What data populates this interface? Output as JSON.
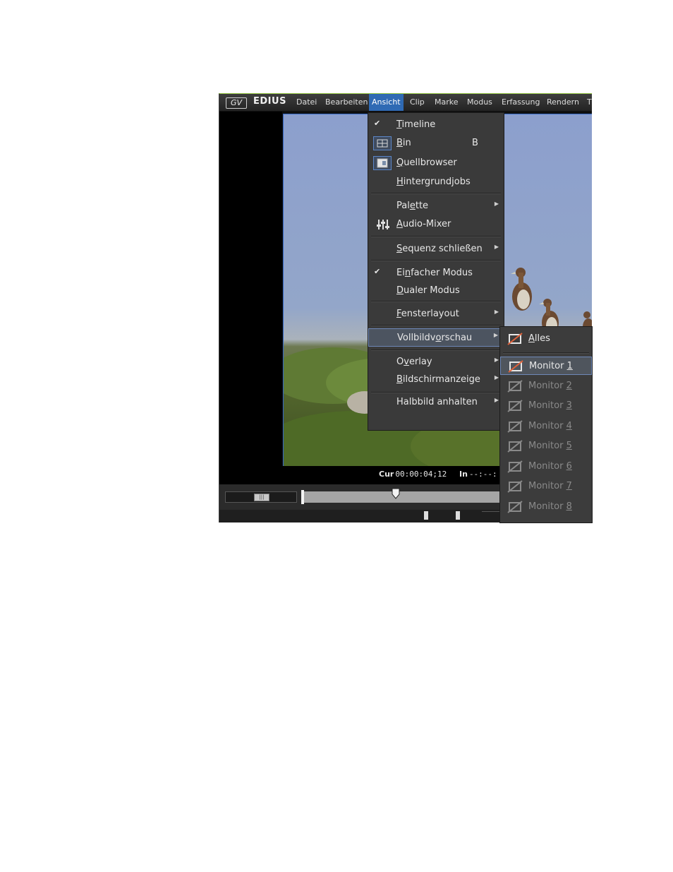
{
  "app": {
    "brand": "EDIUS",
    "logo": "GV",
    "menu": [
      "Datei",
      "Bearbeiten",
      "Ansicht",
      "Clip",
      "Marke",
      "Modus",
      "Erfassung",
      "Rendern",
      "T"
    ]
  },
  "ansicht_menu": {
    "timeline": {
      "pre": "",
      "u": "T",
      "post": "imeline"
    },
    "bin": {
      "pre": "",
      "u": "B",
      "post": "in",
      "accel": "B"
    },
    "quellbrowser": {
      "pre": "",
      "u": "Q",
      "post": "uellbrowser"
    },
    "hintergrundjobs": {
      "pre": "",
      "u": "H",
      "post": "intergrundjobs"
    },
    "palette": {
      "pre": "Pal",
      "u": "e",
      "post": "tte"
    },
    "audio_mixer": {
      "pre": "",
      "u": "A",
      "post": "udio-Mixer"
    },
    "sequenz": {
      "pre": "",
      "u": "S",
      "post": "equenz schließen"
    },
    "einfacher": {
      "pre": "Ei",
      "u": "n",
      "post": "facher Modus"
    },
    "dualer": {
      "pre": "",
      "u": "D",
      "post": "ualer Modus"
    },
    "fensterlayout": {
      "pre": "",
      "u": "F",
      "post": "ensterlayout"
    },
    "vollbild": {
      "pre": "Vollbildv",
      "u": "o",
      "post": "rschau"
    },
    "overlay": {
      "pre": "O",
      "u": "v",
      "post": "erlay"
    },
    "bildschirm": {
      "pre": "",
      "u": "B",
      "post": "ildschirmanzeige"
    },
    "halbbild": {
      "pre": "Halbbild anhalten",
      "u": "",
      "post": ""
    }
  },
  "submenu": {
    "alles": {
      "pre": "",
      "u": "A",
      "post": "lles"
    },
    "monitors": [
      {
        "pre": "Monitor ",
        "u": "1"
      },
      {
        "pre": "Monitor ",
        "u": "2"
      },
      {
        "pre": "Monitor ",
        "u": "3"
      },
      {
        "pre": "Monitor ",
        "u": "4"
      },
      {
        "pre": "Monitor ",
        "u": "5"
      },
      {
        "pre": "Monitor ",
        "u": "6"
      },
      {
        "pre": "Monitor ",
        "u": "7"
      },
      {
        "pre": "Monitor ",
        "u": "8"
      }
    ]
  },
  "timecode": {
    "cur_label": "Cur",
    "cur_value": "00:00:04;12",
    "in_label": "In",
    "in_value": "--:--:"
  },
  "colors": {
    "menubar_active": "#2f6ab4",
    "menu_bg": "#3a3a3a",
    "highlight_border": "#6e88b8",
    "accent_green": "#8fc23e"
  }
}
